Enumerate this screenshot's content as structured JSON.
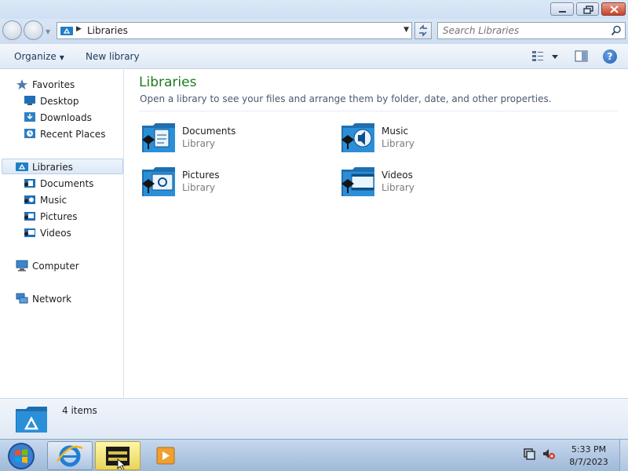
{
  "address": {
    "crumb": "Libraries"
  },
  "search": {
    "placeholder": "Search Libraries"
  },
  "toolbar": {
    "organize_label": "Organize",
    "new_library_label": "New library"
  },
  "nav": {
    "favorites": {
      "label": "Favorites",
      "items": [
        {
          "label": "Desktop"
        },
        {
          "label": "Downloads"
        },
        {
          "label": "Recent Places"
        }
      ]
    },
    "libraries": {
      "label": "Libraries",
      "items": [
        {
          "label": "Documents"
        },
        {
          "label": "Music"
        },
        {
          "label": "Pictures"
        },
        {
          "label": "Videos"
        }
      ]
    },
    "computer": {
      "label": "Computer"
    },
    "network": {
      "label": "Network"
    }
  },
  "main": {
    "title": "Libraries",
    "subtitle": "Open a library to see your files and arrange them by folder, date, and other properties.",
    "tiles": [
      {
        "name": "Documents",
        "type": "Library",
        "icon": "documents-library-icon"
      },
      {
        "name": "Music",
        "type": "Library",
        "icon": "music-library-icon"
      },
      {
        "name": "Pictures",
        "type": "Library",
        "icon": "pictures-library-icon"
      },
      {
        "name": "Videos",
        "type": "Library",
        "icon": "videos-library-icon"
      }
    ]
  },
  "details": {
    "count": "4 items"
  },
  "taskbar": {
    "time": "5:33 PM",
    "date": "8/7/2023"
  },
  "colors": {
    "title_green": "#1e7a1e",
    "accent_blue": "#1f5db3",
    "close_red": "#c8412a"
  }
}
